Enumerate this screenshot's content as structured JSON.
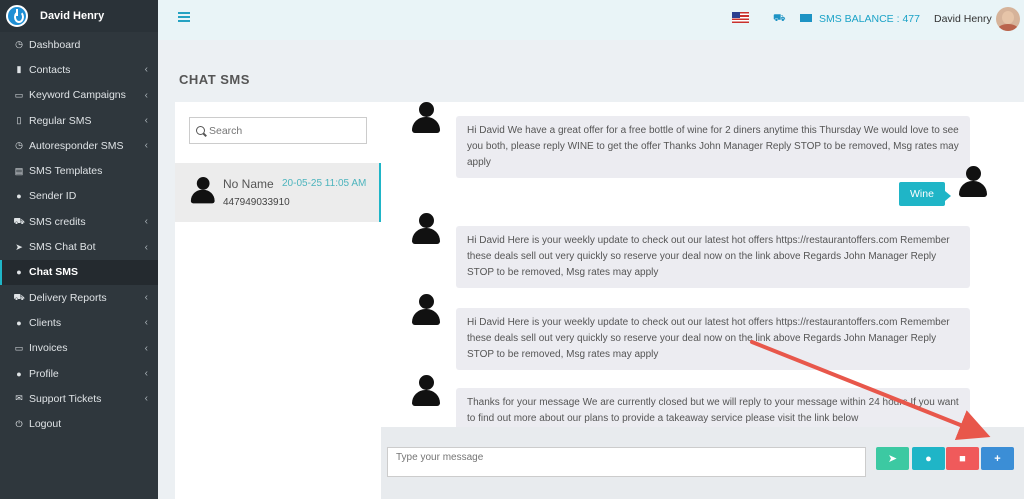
{
  "sidebar": {
    "brand_name": "David Henry",
    "items": [
      {
        "label": "Dashboard",
        "icon": "dashboard-icon",
        "glyph": "◷",
        "chevron": false
      },
      {
        "label": "Contacts",
        "icon": "book-icon",
        "glyph": "▮",
        "chevron": true
      },
      {
        "label": "Keyword Campaigns",
        "icon": "keyboard-icon",
        "glyph": "▭",
        "chevron": true
      },
      {
        "label": "Regular SMS",
        "icon": "mobile-icon",
        "glyph": "▯",
        "chevron": true
      },
      {
        "label": "Autoresponder SMS",
        "icon": "clock-icon",
        "glyph": "◷",
        "chevron": true
      },
      {
        "label": "SMS Templates",
        "icon": "template-icon",
        "glyph": "▤",
        "chevron": false
      },
      {
        "label": "Sender ID",
        "icon": "user-icon",
        "glyph": "●",
        "chevron": false
      },
      {
        "label": "SMS credits",
        "icon": "cart-icon",
        "glyph": "⛟",
        "chevron": true
      },
      {
        "label": "SMS Chat Bot",
        "icon": "paper-plane-icon",
        "glyph": "➤",
        "chevron": true
      },
      {
        "label": "Chat SMS",
        "icon": "chat-icon",
        "glyph": "●",
        "chevron": false,
        "active": true
      },
      {
        "label": "Delivery Reports",
        "icon": "cart-icon",
        "glyph": "⛟",
        "chevron": true
      },
      {
        "label": "Clients",
        "icon": "user-icon",
        "glyph": "●",
        "chevron": true
      },
      {
        "label": "Invoices",
        "icon": "credit-card-icon",
        "glyph": "▭",
        "chevron": true
      },
      {
        "label": "Profile",
        "icon": "user-icon",
        "glyph": "●",
        "chevron": true
      },
      {
        "label": "Support Tickets",
        "icon": "envelope-icon",
        "glyph": "✉",
        "chevron": true
      },
      {
        "label": "Logout",
        "icon": "power-icon",
        "glyph": "⏻",
        "chevron": false
      }
    ]
  },
  "header": {
    "sms_balance": "SMS BALANCE : 477",
    "user_name": "David Henry"
  },
  "page": {
    "title": "CHAT SMS"
  },
  "contacts": {
    "search_placeholder": "Search",
    "list": [
      {
        "name": "No Name",
        "time": "20-05-25 11:05 AM",
        "number": "447949033910"
      }
    ]
  },
  "messages": [
    {
      "direction": "in",
      "text": "Hi David We have a great offer for a free bottle of wine for 2 diners anytime this Thursday We would love to see you both, please reply WINE to get the offer Thanks John Manager Reply STOP to be removed, Msg rates may apply"
    },
    {
      "direction": "out",
      "text": "Wine"
    },
    {
      "direction": "in",
      "text": "Hi David Here is your weekly update to check out our latest hot offers https://restaurantoffers.com Remember these deals sell out very quickly so reserve your deal now on the link above Regards John Manager Reply STOP to be removed, Msg rates may apply"
    },
    {
      "direction": "in",
      "text": "Hi David Here is your weekly update to check out our latest hot offers https://restaurantoffers.com Remember these deals sell out very quickly so reserve your deal now on the link above Regards John Manager Reply STOP to be removed, Msg rates may apply"
    },
    {
      "direction": "in",
      "text": "Thanks for your message We are currently closed but we will reply to your message within 24 hours If you want to find out more about our plans to provide a takeaway service please visit the link below"
    }
  ],
  "composer": {
    "placeholder": "Type your message",
    "buttons": {
      "send": "➤",
      "contact": "●",
      "delete": "■",
      "add": "+"
    }
  },
  "colors": {
    "accent": "#1fb5c7",
    "sidebar_bg": "#2f373d",
    "annotation_arrow": "#e8574b"
  }
}
